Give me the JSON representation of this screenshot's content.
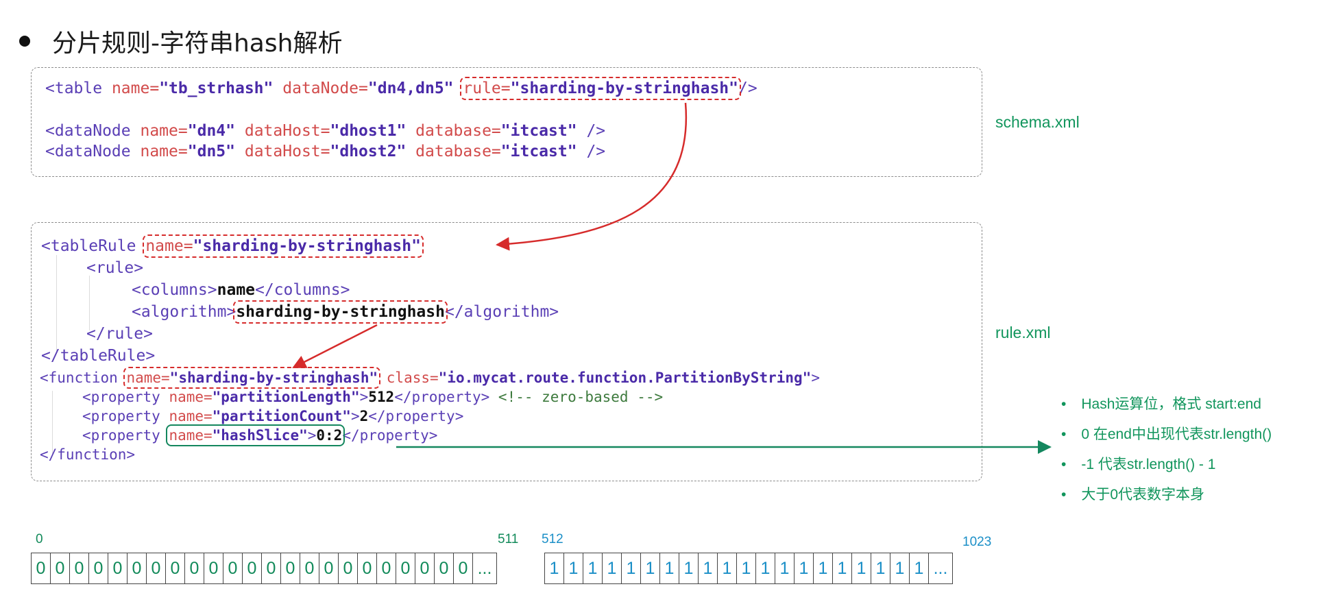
{
  "title": "分片规则-字符串hash解析",
  "schema": {
    "label": "schema.xml",
    "table": {
      "name": "tb_strhash",
      "dataNode": "dn4,dn5",
      "rule": "sharding-by-stringhash"
    },
    "dataNodes": [
      {
        "name": "dn4",
        "dataHost": "dhost1",
        "database": "itcast"
      },
      {
        "name": "dn5",
        "dataHost": "dhost2",
        "database": "itcast"
      }
    ]
  },
  "rule": {
    "label": "rule.xml",
    "tableRule_name": "sharding-by-stringhash",
    "columns": "name",
    "algorithm": "sharding-by-stringhash",
    "function": {
      "name": "sharding-by-stringhash",
      "class": "io.mycat.route.function.PartitionByString",
      "partitionLength": "512",
      "partitionLength_comment": "<!-- zero-based -->",
      "partitionCount": "2",
      "hashSlice": "0:2"
    }
  },
  "notes": [
    "Hash运算位，格式 start:end",
    "0 在end中出现代表str.length()",
    "-1 代表str.length() - 1",
    "大于0代表数字本身"
  ],
  "partitions": {
    "first": {
      "start_label": "0",
      "end_label": "511",
      "cells": [
        "0",
        "0",
        "0",
        "0",
        "0",
        "0",
        "0",
        "0",
        "0",
        "0",
        "0",
        "0",
        "0",
        "0",
        "0",
        "0",
        "0",
        "0",
        "0",
        "0",
        "0",
        "0",
        "0",
        "..."
      ]
    },
    "second": {
      "start_label": "512",
      "end_label": "1023",
      "cells": [
        "1",
        "1",
        "1",
        "1",
        "1",
        "1",
        "1",
        "1",
        "1",
        "1",
        "1",
        "1",
        "1",
        "1",
        "1",
        "1",
        "1",
        "1",
        "1",
        "1",
        "..."
      ]
    }
  },
  "colors": {
    "accent_green": "#11955c",
    "highlight_red": "#d62b2b",
    "cell_blue": "#1b8fc7"
  }
}
